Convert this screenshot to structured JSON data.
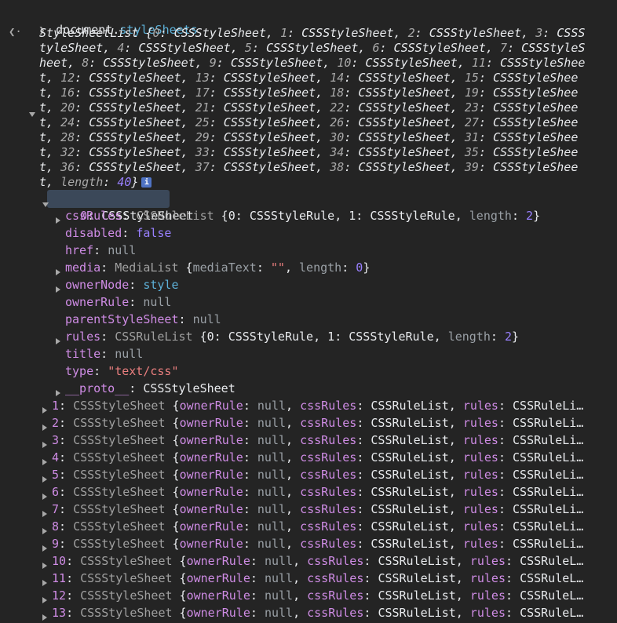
{
  "input": {
    "object": "document",
    "dot": ".",
    "property": "styleSheets"
  },
  "summary": {
    "type": "StyleSheetList",
    "open": "{",
    "close": "}",
    "count": 40,
    "entry_class": "CSSStyleSheet",
    "length_key": "length",
    "info_glyph": "i"
  },
  "expanded": {
    "index_label": "0",
    "class": "CSSStyleSheet",
    "props": [
      {
        "key": "cssRules",
        "expandable": true,
        "parts": [
          {
            "t": "CSSRuleList",
            "c": "cls-dim"
          },
          {
            "t": " {",
            "c": "white"
          },
          {
            "t": "0",
            "c": "white"
          },
          {
            "t": ": ",
            "c": "white"
          },
          {
            "t": "CSSStyleRule",
            "c": "white"
          },
          {
            "t": ", ",
            "c": "white"
          },
          {
            "t": "1",
            "c": "white"
          },
          {
            "t": ": ",
            "c": "white"
          },
          {
            "t": "CSSStyleRule",
            "c": "white"
          },
          {
            "t": ", ",
            "c": "white"
          },
          {
            "t": "length",
            "c": "gray"
          },
          {
            "t": ": ",
            "c": "white"
          },
          {
            "t": "2",
            "c": "numv"
          },
          {
            "t": "}",
            "c": "white"
          }
        ]
      },
      {
        "key": "disabled",
        "expandable": false,
        "parts": [
          {
            "t": "false",
            "c": "blue-bool"
          }
        ]
      },
      {
        "key": "href",
        "expandable": false,
        "parts": [
          {
            "t": "null",
            "c": "null"
          }
        ]
      },
      {
        "key": "media",
        "expandable": true,
        "parts": [
          {
            "t": "MediaList",
            "c": "cls-dim"
          },
          {
            "t": " {",
            "c": "white"
          },
          {
            "t": "mediaText",
            "c": "gray"
          },
          {
            "t": ": ",
            "c": "white"
          },
          {
            "t": "\"\"",
            "c": "str-inner"
          },
          {
            "t": ", ",
            "c": "white"
          },
          {
            "t": "length",
            "c": "gray"
          },
          {
            "t": ": ",
            "c": "white"
          },
          {
            "t": "0",
            "c": "numv"
          },
          {
            "t": "}",
            "c": "white"
          }
        ]
      },
      {
        "key": "ownerNode",
        "expandable": true,
        "parts": [
          {
            "t": "style",
            "c": "node"
          }
        ]
      },
      {
        "key": "ownerRule",
        "expandable": false,
        "parts": [
          {
            "t": "null",
            "c": "null"
          }
        ]
      },
      {
        "key": "parentStyleSheet",
        "expandable": false,
        "parts": [
          {
            "t": "null",
            "c": "null"
          }
        ]
      },
      {
        "key": "rules",
        "expandable": true,
        "parts": [
          {
            "t": "CSSRuleList",
            "c": "cls-dim"
          },
          {
            "t": " {",
            "c": "white"
          },
          {
            "t": "0",
            "c": "white"
          },
          {
            "t": ": ",
            "c": "white"
          },
          {
            "t": "CSSStyleRule",
            "c": "white"
          },
          {
            "t": ", ",
            "c": "white"
          },
          {
            "t": "1",
            "c": "white"
          },
          {
            "t": ": ",
            "c": "white"
          },
          {
            "t": "CSSStyleRule",
            "c": "white"
          },
          {
            "t": ", ",
            "c": "white"
          },
          {
            "t": "length",
            "c": "gray"
          },
          {
            "t": ": ",
            "c": "white"
          },
          {
            "t": "2",
            "c": "numv"
          },
          {
            "t": "}",
            "c": "white"
          }
        ]
      },
      {
        "key": "title",
        "expandable": false,
        "parts": [
          {
            "t": "null",
            "c": "null"
          }
        ]
      },
      {
        "key": "type",
        "expandable": false,
        "parts": [
          {
            "t": "\"text/css\"",
            "c": "str-inner"
          }
        ]
      },
      {
        "key": "__proto__",
        "expandable": true,
        "parts": [
          {
            "t": "CSSStyleSheet",
            "c": "white"
          }
        ]
      }
    ]
  },
  "collapsed_rows": [
    {
      "index": "1"
    },
    {
      "index": "2"
    },
    {
      "index": "3"
    },
    {
      "index": "4"
    },
    {
      "index": "5"
    },
    {
      "index": "6"
    },
    {
      "index": "7"
    },
    {
      "index": "8"
    },
    {
      "index": "9"
    },
    {
      "index": "10"
    },
    {
      "index": "11"
    },
    {
      "index": "12"
    },
    {
      "index": "13"
    }
  ],
  "collapsed_preview": {
    "class": "CSSStyleSheet",
    "k_ownerRule": "ownerRule",
    "v_null": "null",
    "k_cssRules": "cssRules",
    "v_rulelist": "CSSRuleList",
    "k_rules": "rules",
    "v_rulelist_trunc_1": "CSSRuleLi…",
    "v_rulelist_trunc_2": "CSSRuleL…"
  },
  "colors": {
    "background": "#242424",
    "index_pink": "#cf8ce5",
    "number_purple": "#9980ff",
    "string_red": "#e97e7e",
    "node_blue": "#5db0d7",
    "selected_bg": "#3b4859"
  }
}
